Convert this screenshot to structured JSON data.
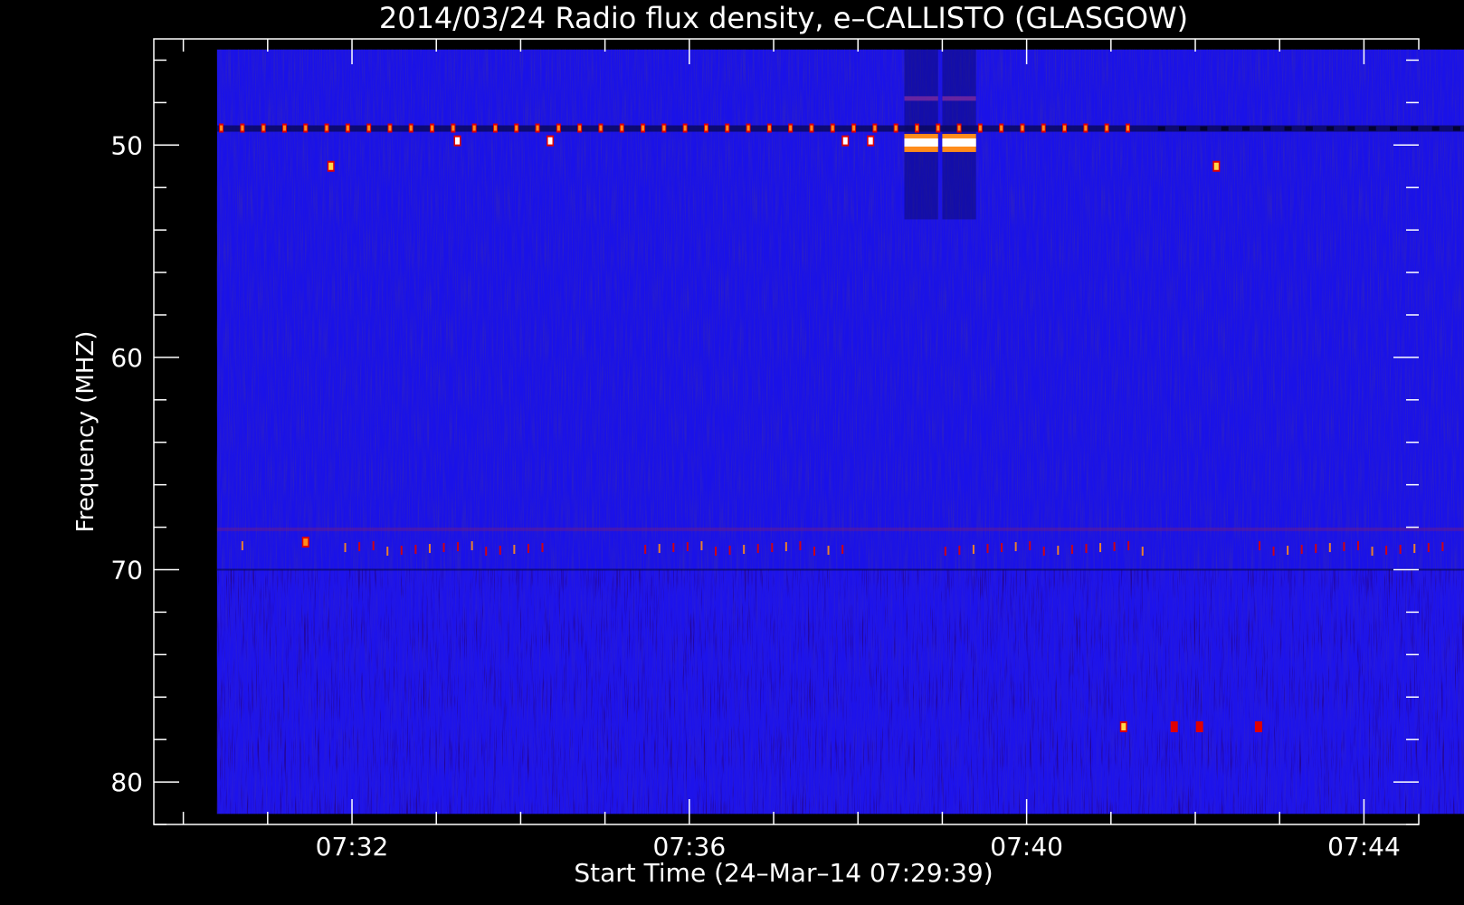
{
  "chart_data": {
    "type": "heatmap",
    "title": "2014/03/24  Radio flux density, e–CALLISTO (GLASGOW)",
    "xlabel": "Start Time (24–Mar–14 07:29:39)",
    "ylabel": "Frequency (MHZ)",
    "x_range": [
      "07:29:39",
      "07:44:39"
    ],
    "xlim_minutes": [
      0.0,
      15.0
    ],
    "ylim": [
      45.0,
      82.0
    ],
    "y_inverted": true,
    "x_ticks": [
      {
        "label": "07:32",
        "minutes": 2.35
      },
      {
        "label": "07:36",
        "minutes": 6.35
      },
      {
        "label": "07:40",
        "minutes": 10.35
      },
      {
        "label": "07:44",
        "minutes": 14.35
      }
    ],
    "y_ticks": [
      50,
      60,
      70,
      80
    ],
    "data_extent": {
      "x_minutes": [
        0.75,
        15.75
      ],
      "y_mhz": [
        45.5,
        81.5
      ]
    },
    "colors": {
      "background": "#000000",
      "axes": "#ffffff",
      "low": "#1a12e8",
      "mid": "#2418f0",
      "dark": "#0a0860",
      "red": "#e00000",
      "orange": "#ff8c1a",
      "yellow": "#ffd84a",
      "white": "#ffffff"
    },
    "features": {
      "band_49mhz_dots": {
        "freq_mhz": 49.2,
        "start_minutes": 0.8,
        "end_minutes": 11.7,
        "step_minutes": 0.25
      },
      "bursts": [
        {
          "t": 2.1,
          "f": 51.0,
          "color": "yellow"
        },
        {
          "t": 3.6,
          "f": 49.8,
          "color": "white"
        },
        {
          "t": 4.7,
          "f": 49.8,
          "color": "white"
        },
        {
          "t": 8.2,
          "f": 49.8,
          "color": "white"
        },
        {
          "t": 8.5,
          "f": 49.8,
          "color": "white"
        },
        {
          "t": 12.6,
          "f": 51.0,
          "color": "yellow"
        },
        {
          "t": 11.5,
          "f": 77.4,
          "color": "yellow"
        },
        {
          "t": 12.1,
          "f": 77.4,
          "color": "red"
        },
        {
          "t": 12.4,
          "f": 77.4,
          "color": "red"
        },
        {
          "t": 13.1,
          "f": 77.4,
          "color": "red"
        },
        {
          "t": 1.8,
          "f": 68.7,
          "color": "orange"
        }
      ],
      "strong_bursts": [
        {
          "t_start": 8.9,
          "t_end": 9.3,
          "f": 49.9
        },
        {
          "t_start": 9.35,
          "t_end": 9.75,
          "f": 49.9
        }
      ],
      "rfi_band_mhz": 69.0,
      "noisy_region_mhz": [
        70.0,
        81.5
      ]
    }
  }
}
